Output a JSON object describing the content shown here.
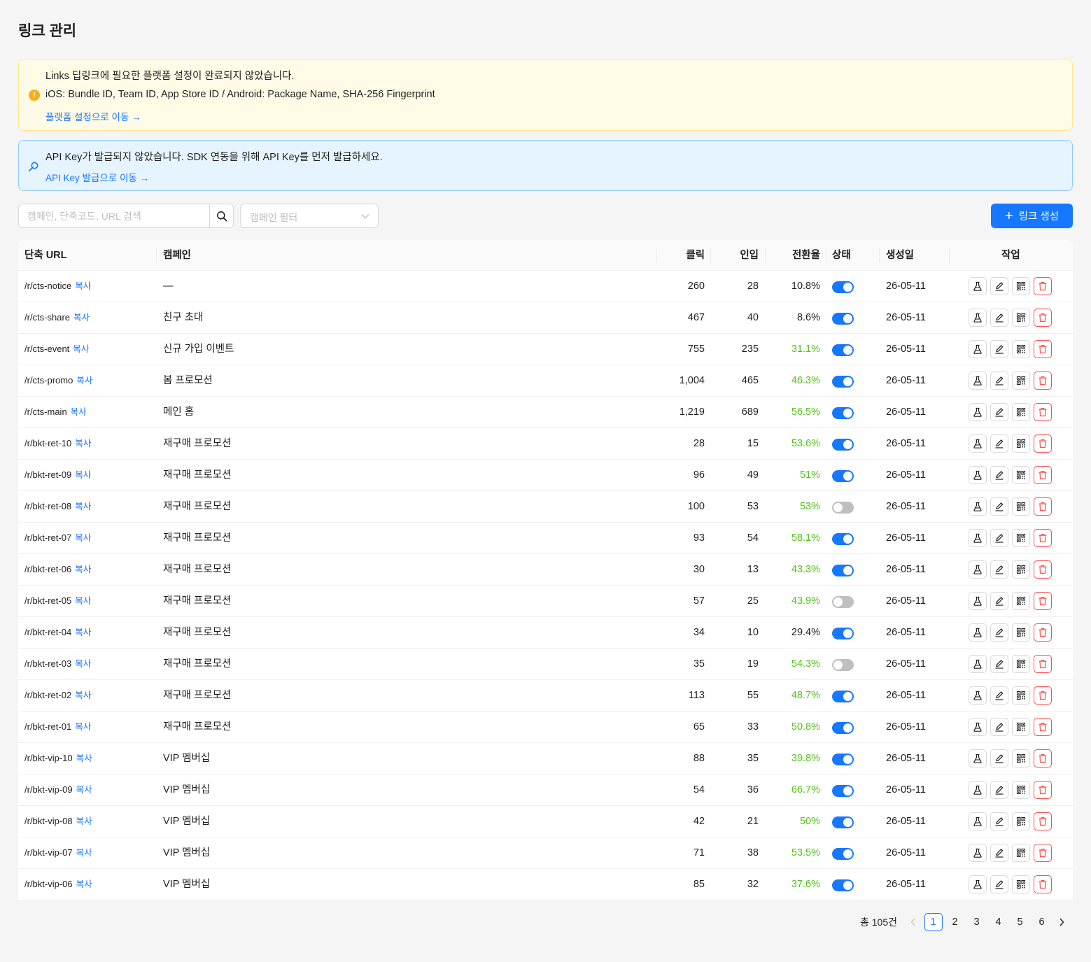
{
  "page": {
    "title": "링크 관리"
  },
  "alerts": {
    "warning": {
      "icon": "exclamation-circle-icon",
      "line1": "Links 딥링크에 필요한 플랫폼 설정이 완료되지 않았습니다.",
      "line2": "iOS: Bundle ID, Team ID, App Store ID / Android: Package Name, SHA-256 Fingerprint",
      "link": "플랫폼 설정으로 이동 →",
      "color": "#faad14"
    },
    "info": {
      "icon": "search-icon",
      "line1": "API Key가 발급되지 않았습니다. SDK 연동을 위해 API Key를 먼저 발급하세요.",
      "link": "API Key 발급으로 이동 →",
      "color": "#1677ff"
    }
  },
  "toolbar": {
    "search_placeholder": "캠페인, 단축코드, URL 검색",
    "search_value": "",
    "filter_placeholder": "캠페인 필터",
    "create_label": "링크 생성"
  },
  "table": {
    "headers": {
      "url": "단축 URL",
      "campaign": "캠페인",
      "clicks": "클릭",
      "installs": "인입",
      "rate": "전환율",
      "status": "상태",
      "created": "생성일",
      "actions": "작업"
    },
    "copy_label": "복사",
    "rows": [
      {
        "url": "/r/cts-notice",
        "campaign": "—",
        "clicks": "260",
        "installs": "28",
        "rate": "10.8%",
        "high": false,
        "enabled": true,
        "created": "26-05-11"
      },
      {
        "url": "/r/cts-share",
        "campaign": "친구 초대",
        "clicks": "467",
        "installs": "40",
        "rate": "8.6%",
        "high": false,
        "enabled": true,
        "created": "26-05-11"
      },
      {
        "url": "/r/cts-event",
        "campaign": "신규 가입 이벤트",
        "clicks": "755",
        "installs": "235",
        "rate": "31.1%",
        "high": true,
        "enabled": true,
        "created": "26-05-11"
      },
      {
        "url": "/r/cts-promo",
        "campaign": "봄 프로모션",
        "clicks": "1,004",
        "installs": "465",
        "rate": "46.3%",
        "high": true,
        "enabled": true,
        "created": "26-05-11"
      },
      {
        "url": "/r/cts-main",
        "campaign": "메인 홈",
        "clicks": "1,219",
        "installs": "689",
        "rate": "56.5%",
        "high": true,
        "enabled": true,
        "created": "26-05-11"
      },
      {
        "url": "/r/bkt-ret-10",
        "campaign": "재구매 프로모션",
        "clicks": "28",
        "installs": "15",
        "rate": "53.6%",
        "high": true,
        "enabled": true,
        "created": "26-05-11"
      },
      {
        "url": "/r/bkt-ret-09",
        "campaign": "재구매 프로모션",
        "clicks": "96",
        "installs": "49",
        "rate": "51%",
        "high": true,
        "enabled": true,
        "created": "26-05-11"
      },
      {
        "url": "/r/bkt-ret-08",
        "campaign": "재구매 프로모션",
        "clicks": "100",
        "installs": "53",
        "rate": "53%",
        "high": true,
        "enabled": false,
        "created": "26-05-11"
      },
      {
        "url": "/r/bkt-ret-07",
        "campaign": "재구매 프로모션",
        "clicks": "93",
        "installs": "54",
        "rate": "58.1%",
        "high": true,
        "enabled": true,
        "created": "26-05-11"
      },
      {
        "url": "/r/bkt-ret-06",
        "campaign": "재구매 프로모션",
        "clicks": "30",
        "installs": "13",
        "rate": "43.3%",
        "high": true,
        "enabled": true,
        "created": "26-05-11"
      },
      {
        "url": "/r/bkt-ret-05",
        "campaign": "재구매 프로모션",
        "clicks": "57",
        "installs": "25",
        "rate": "43.9%",
        "high": true,
        "enabled": false,
        "created": "26-05-11"
      },
      {
        "url": "/r/bkt-ret-04",
        "campaign": "재구매 프로모션",
        "clicks": "34",
        "installs": "10",
        "rate": "29.4%",
        "high": false,
        "enabled": true,
        "created": "26-05-11"
      },
      {
        "url": "/r/bkt-ret-03",
        "campaign": "재구매 프로모션",
        "clicks": "35",
        "installs": "19",
        "rate": "54.3%",
        "high": true,
        "enabled": false,
        "created": "26-05-11"
      },
      {
        "url": "/r/bkt-ret-02",
        "campaign": "재구매 프로모션",
        "clicks": "113",
        "installs": "55",
        "rate": "48.7%",
        "high": true,
        "enabled": true,
        "created": "26-05-11"
      },
      {
        "url": "/r/bkt-ret-01",
        "campaign": "재구매 프로모션",
        "clicks": "65",
        "installs": "33",
        "rate": "50.8%",
        "high": true,
        "enabled": true,
        "created": "26-05-11"
      },
      {
        "url": "/r/bkt-vip-10",
        "campaign": "VIP 멤버십",
        "clicks": "88",
        "installs": "35",
        "rate": "39.8%",
        "high": true,
        "enabled": true,
        "created": "26-05-11"
      },
      {
        "url": "/r/bkt-vip-09",
        "campaign": "VIP 멤버십",
        "clicks": "54",
        "installs": "36",
        "rate": "66.7%",
        "high": true,
        "enabled": true,
        "created": "26-05-11"
      },
      {
        "url": "/r/bkt-vip-08",
        "campaign": "VIP 멤버십",
        "clicks": "42",
        "installs": "21",
        "rate": "50%",
        "high": true,
        "enabled": true,
        "created": "26-05-11"
      },
      {
        "url": "/r/bkt-vip-07",
        "campaign": "VIP 멤버십",
        "clicks": "71",
        "installs": "38",
        "rate": "53.5%",
        "high": true,
        "enabled": true,
        "created": "26-05-11"
      },
      {
        "url": "/r/bkt-vip-06",
        "campaign": "VIP 멤버십",
        "clicks": "85",
        "installs": "32",
        "rate": "37.6%",
        "high": true,
        "enabled": true,
        "created": "26-05-11"
      }
    ],
    "row_action_icons": [
      "flask-icon",
      "edit-icon",
      "qrcode-icon",
      "delete-icon"
    ]
  },
  "pagination": {
    "total": "총 105건",
    "pages": [
      "1",
      "2",
      "3",
      "4",
      "5",
      "6"
    ],
    "current": "1"
  },
  "colors": {
    "primary": "#1677ff",
    "success": "#52c41a",
    "danger": "#ff4d4f",
    "toggle_off": "#bfbfbf"
  }
}
